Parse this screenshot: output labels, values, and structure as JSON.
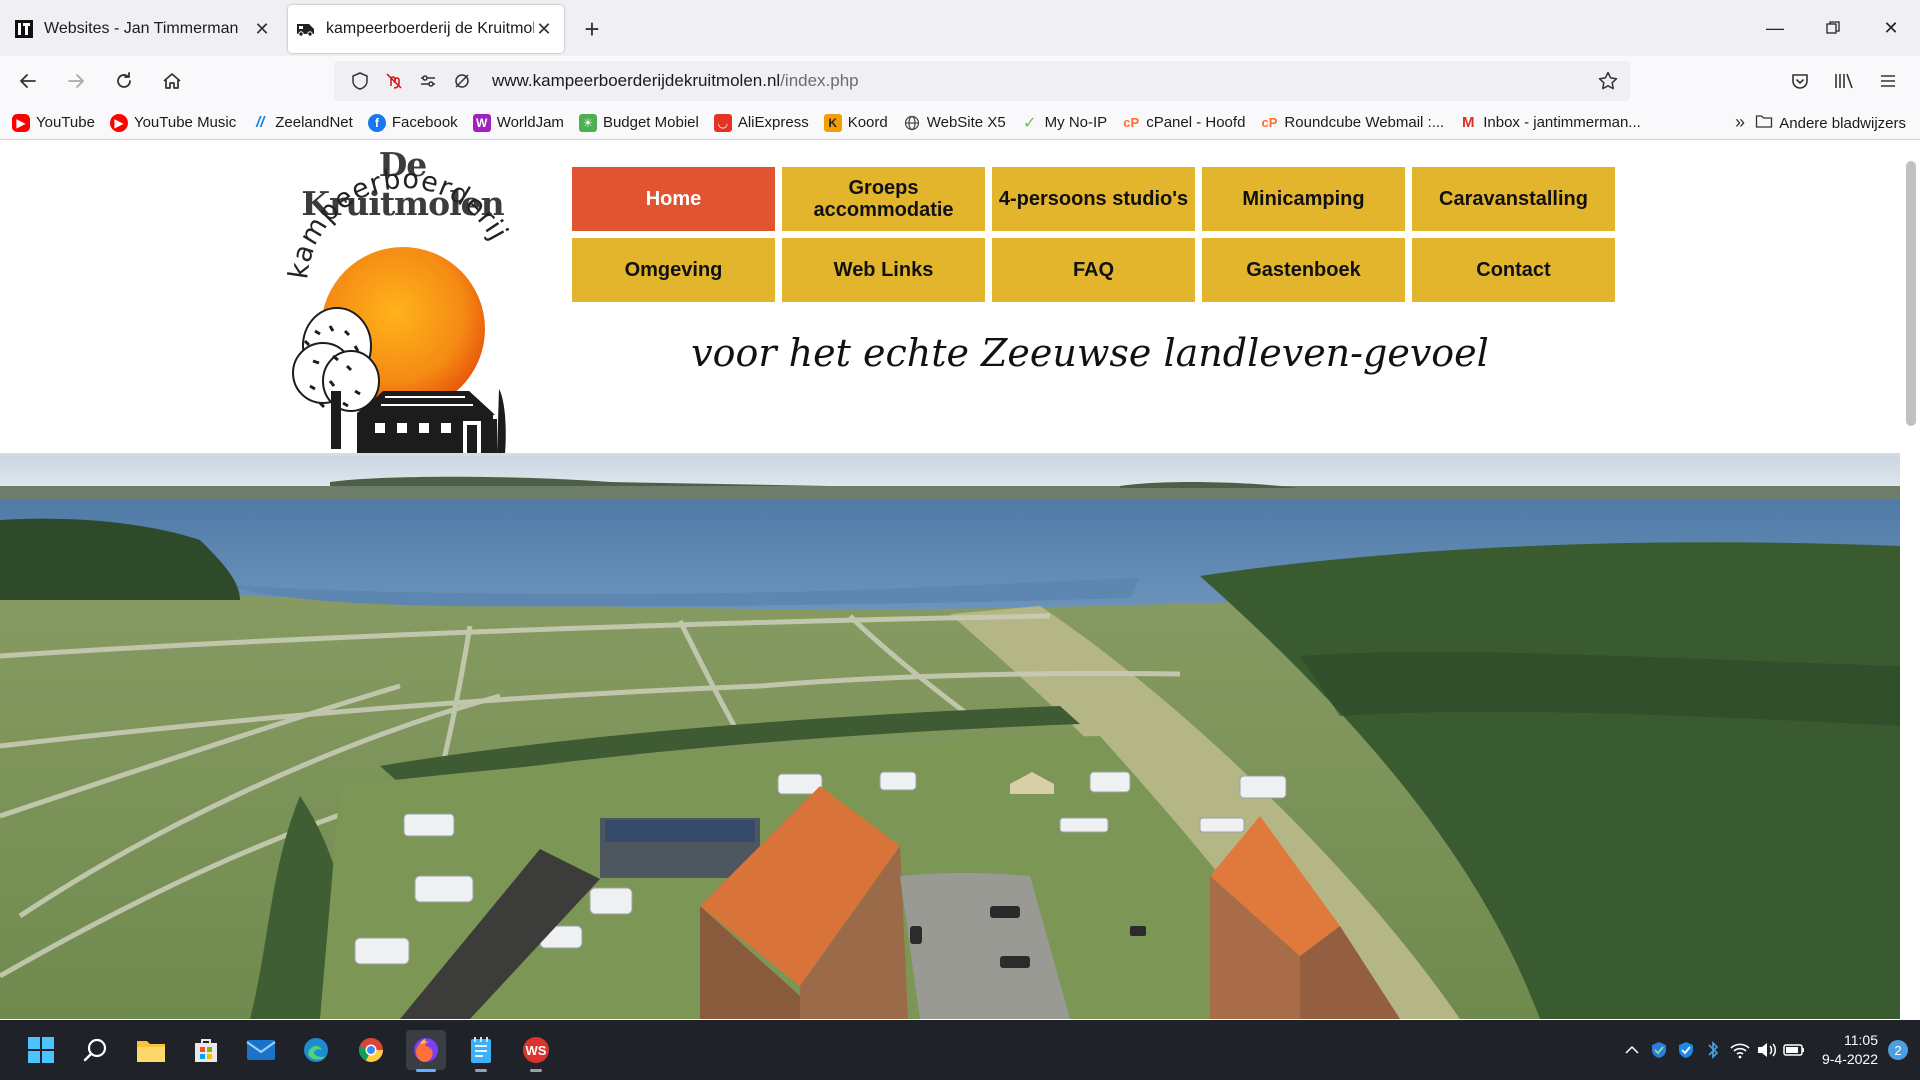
{
  "browser": {
    "tabs": [
      {
        "title": "Websites - Jan Timmerman",
        "active": false
      },
      {
        "title": "kampeerboerderij de Kruitmolen",
        "active": true
      }
    ],
    "new_tab_label": "+",
    "url_domain": "www.kampeerboerderijdekruitmolen.nl",
    "url_path": "/index.php",
    "bookmarks": [
      {
        "label": "YouTube",
        "icon": "youtube-icon",
        "color": "#ff0000"
      },
      {
        "label": "YouTube Music",
        "icon": "youtube-music-icon",
        "color": "#ff0000"
      },
      {
        "label": "ZeelandNet",
        "icon": "zeelandnet-icon",
        "color": "#1c7ed6"
      },
      {
        "label": "Facebook",
        "icon": "facebook-icon",
        "color": "#1877f2"
      },
      {
        "label": "WorldJam",
        "icon": "worldjam-icon",
        "color": "#a020c0"
      },
      {
        "label": "Budget Mobiel",
        "icon": "budget-mobiel-icon",
        "color": "#4caf50"
      },
      {
        "label": "AliExpress",
        "icon": "aliexpress-icon",
        "color": "#e43225"
      },
      {
        "label": "Koord",
        "icon": "koord-icon",
        "color": "#f29f05"
      },
      {
        "label": "WebSite X5",
        "icon": "globe-icon",
        "color": "#444444"
      },
      {
        "label": "My No-IP",
        "icon": "noip-icon",
        "color": "#6abf3a"
      },
      {
        "label": "cPanel - Hoofd",
        "icon": "cpanel-icon",
        "color": "#ff6c2c"
      },
      {
        "label": "Roundcube Webmail :...",
        "icon": "roundcube-icon",
        "color": "#ff6c2c"
      },
      {
        "label": "Inbox - jantimmerman...",
        "icon": "gmail-icon",
        "color": "#d93025"
      }
    ],
    "other_bookmarks": "Andere bladwijzers"
  },
  "site": {
    "logo_title": "De Kruitmolen",
    "logo_arc_text": "kampeerboerderij",
    "menu": [
      {
        "label": "Home",
        "active": true
      },
      {
        "label": "Groeps accommodatie",
        "active": false
      },
      {
        "label": "4-persoons studio's",
        "active": false
      },
      {
        "label": "Minicamping",
        "active": false
      },
      {
        "label": "Caravanstalling",
        "active": false
      },
      {
        "label": "Omgeving",
        "active": false
      },
      {
        "label": "Web Links",
        "active": false
      },
      {
        "label": "FAQ",
        "active": false
      },
      {
        "label": "Gastenboek",
        "active": false
      },
      {
        "label": "Contact",
        "active": false
      }
    ],
    "slogan": "voor het echte Zeeuwse landleven-gevoel",
    "colors": {
      "menu": "#e3b52c",
      "menu_active": "#e05432"
    }
  },
  "taskbar": {
    "time": "11:05",
    "date": "9-4-2022",
    "notification_count": "2",
    "ws_label": "WS"
  }
}
